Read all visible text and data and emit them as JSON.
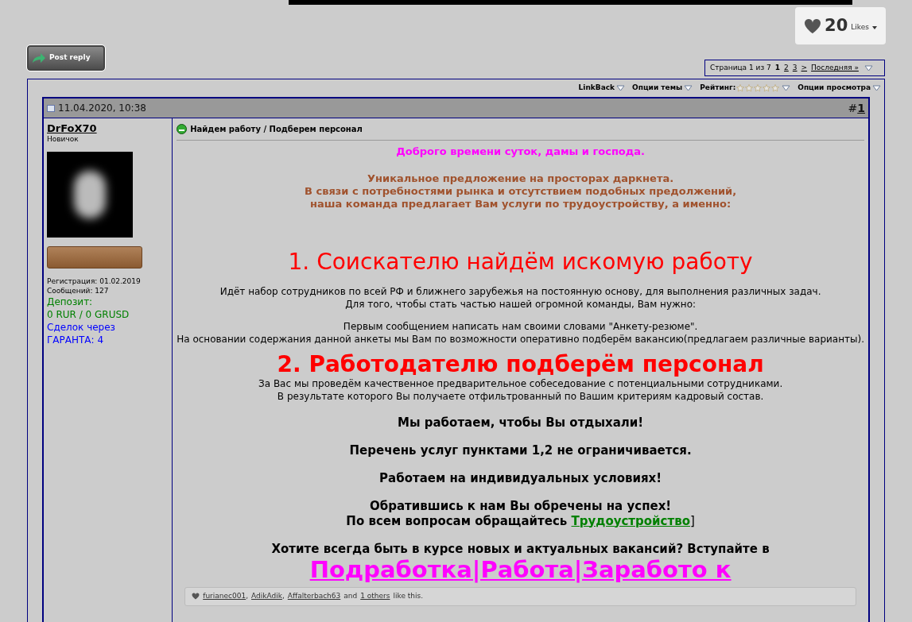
{
  "likes": {
    "count": "20",
    "label": "Likes"
  },
  "post_reply": {
    "label": "Post reply"
  },
  "pagination": {
    "label": "Страница 1 из 7",
    "pages": [
      {
        "label": "1",
        "selected": true
      },
      {
        "label": "2",
        "selected": false
      },
      {
        "label": "3",
        "selected": false
      }
    ],
    "next": ">",
    "last": "Последняя »"
  },
  "toolbar": {
    "items": [
      {
        "kind": "menu",
        "label": "LinkBack"
      },
      {
        "kind": "menu",
        "label": "Опции темы"
      },
      {
        "kind": "rating",
        "label": "Рейтинг:",
        "stars": 0
      },
      {
        "kind": "menu",
        "label": "Опции просмотра"
      }
    ]
  },
  "post": {
    "date": "11.04.2020, 10:38",
    "number_prefix": "#",
    "number": "1",
    "author": {
      "name": "DrFoX70",
      "rank": "Новичок",
      "stats": [
        {
          "kind": "plain",
          "text": "Регистрация: 01.02.2019"
        },
        {
          "kind": "plain",
          "text": "Сообщений: 127"
        },
        {
          "kind": "green",
          "text": "Депозит:"
        },
        {
          "kind": "green",
          "text": "0 RUR / 0 GRUSD"
        },
        {
          "kind": "blue",
          "text": "Сделок через"
        },
        {
          "kind": "blue",
          "text": "ГАРАНТА: 4"
        }
      ]
    },
    "title": "Найдем работу / Подберем персонал",
    "blocks": [
      {
        "kind": "greeting",
        "lines": [
          "Доброго времени суток, дамы и господа."
        ]
      },
      {
        "kind": "intro",
        "lines": [
          "Уникальное предложение на просторах даркнета.",
          "В связи с потребностями рынка и отсутствием подобных предолжений,",
          "наша команда предлагает Вам услуги по трудоустройству, а именно:"
        ]
      },
      {
        "kind": "heading1",
        "lines": [
          "1. Соискателю найдём искомую работу"
        ]
      },
      {
        "kind": "paragraph",
        "lines": [
          "Идёт набор сотрудников по всей РФ и ближнего зарубежья на постоянную основу, для выполнения различных задач.",
          "Для того, чтобы стать частью нашей огромной команды, Вам нужно:"
        ]
      },
      {
        "kind": "paragraph",
        "lines": [
          "Первым сообщением написать нам своими словами \"Анкету-резюме\".",
          "На основании содержания данной анкеты мы Вам по возможности оперативно подберём вакансию(предлагаем различные варианты)."
        ]
      },
      {
        "kind": "heading2",
        "lines": [
          "2. Работодателю подберём персонал"
        ]
      },
      {
        "kind": "paragraph_tight",
        "lines": [
          "За Вас мы проведём качественное предварительное собеседование с потенциальными сотрудниками.",
          "В результате которого Вы получаете отфильтрованный по Вашим критериям кадровый состав."
        ]
      },
      {
        "kind": "bold",
        "lines": [
          "Мы работаем, чтобы Вы отдыхали!"
        ]
      },
      {
        "kind": "bold",
        "lines": [
          "Перечень услуг пунктами 1,2 не ограничивается."
        ]
      },
      {
        "kind": "bold",
        "lines": [
          "Работаем на индивидуальных условиях!"
        ]
      },
      {
        "kind": "bold",
        "lines": [
          "Обратившись к нам Вы обречены на успех!"
        ]
      },
      {
        "kind": "contact",
        "text": "По всем вопросам обращайтесь",
        "link": "Трудоустройство",
        "suffix": "]"
      },
      {
        "kind": "bold_spaced",
        "lines": [
          "Хотите всегда быть в курсе новых и актуальных вакансий? Вступайте в"
        ]
      },
      {
        "kind": "biglink",
        "lines": [
          "Подработка|Работа|Заработо к"
        ]
      }
    ],
    "likes_bar": {
      "users": [
        {
          "name": "furianec001",
          "sep": ","
        },
        {
          "name": "AdikAdik",
          "sep": ","
        },
        {
          "name": "Affalterbach63"
        }
      ],
      "and": "and",
      "others": "1 others",
      "suffix": "like this."
    }
  }
}
